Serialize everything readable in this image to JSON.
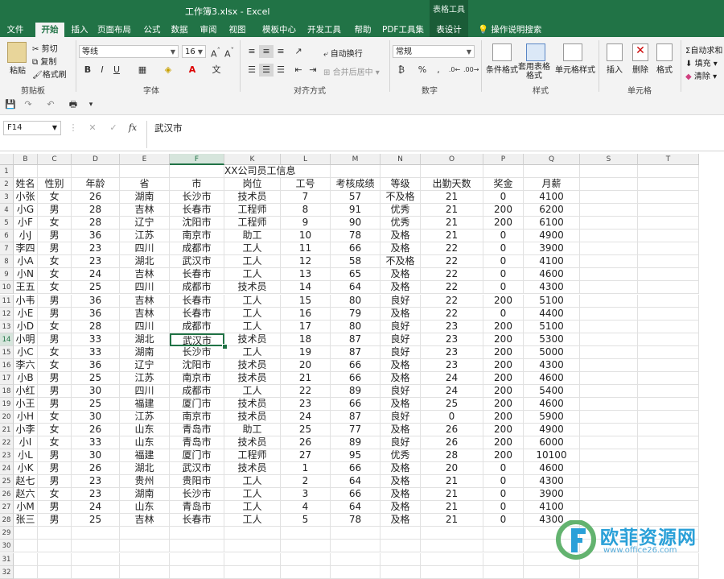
{
  "window": {
    "title": "工作簿3.xlsx  -  Excel",
    "context_group": "表格工具"
  },
  "tabs": [
    "文件",
    "开始",
    "插入",
    "页面布局",
    "公式",
    "数据",
    "审阅",
    "视图",
    "模板中心",
    "开发工具",
    "帮助",
    "PDF工具集",
    "表设计"
  ],
  "active_tab": "开始",
  "tell_me": "操作说明搜索",
  "ribbon": {
    "clipboard": {
      "paste": "粘贴",
      "cut": "剪切",
      "copy": "复制",
      "format_painter": "格式刷",
      "label": "剪贴板"
    },
    "font": {
      "name": "等线",
      "size": "16",
      "bold": "B",
      "italic": "I",
      "underline": "U",
      "label": "字体"
    },
    "alignment": {
      "wrap": "自动换行",
      "merge": "合并后居中",
      "label": "对齐方式"
    },
    "number": {
      "format": "常规",
      "percent": "%",
      "label": "数字"
    },
    "styles": {
      "conditional": "条件格式",
      "table": "套用表格格式",
      "cell_styles": "单元格样式",
      "label": "样式"
    },
    "cells": {
      "insert": "插入",
      "delete": "删除",
      "format": "格式",
      "label": "单元格"
    },
    "editing": {
      "autosum": "自动求和",
      "fill": "填充",
      "clear": "清除"
    }
  },
  "formula_bar": {
    "name_box": "F14",
    "content": "武汉市"
  },
  "columns": [
    "B",
    "C",
    "D",
    "E",
    "F",
    "K",
    "L",
    "M",
    "N",
    "O",
    "P",
    "Q",
    "S",
    "T"
  ],
  "selected_column": "F",
  "selected_row": 14,
  "sheet_title": "XX公司员工信息",
  "headers": [
    "姓名",
    "性别",
    "年龄",
    "省",
    "市",
    "岗位",
    "工号",
    "考核成绩",
    "等级",
    "出勤天数",
    "奖金",
    "月薪"
  ],
  "rows": [
    [
      "小张",
      "女",
      "26",
      "湖南",
      "长沙市",
      "技术员",
      "7",
      "57",
      "不及格",
      "21",
      "0",
      "4100"
    ],
    [
      "小G",
      "男",
      "28",
      "吉林",
      "长春市",
      "工程师",
      "8",
      "91",
      "优秀",
      "21",
      "200",
      "6200"
    ],
    [
      "小F",
      "女",
      "28",
      "辽宁",
      "沈阳市",
      "工程师",
      "9",
      "90",
      "优秀",
      "21",
      "200",
      "6100"
    ],
    [
      "小J",
      "男",
      "36",
      "江苏",
      "南京市",
      "助工",
      "10",
      "78",
      "及格",
      "21",
      "0",
      "4900"
    ],
    [
      "李四",
      "男",
      "23",
      "四川",
      "成都市",
      "工人",
      "11",
      "66",
      "及格",
      "22",
      "0",
      "3900"
    ],
    [
      "小A",
      "女",
      "23",
      "湖北",
      "武汉市",
      "工人",
      "12",
      "58",
      "不及格",
      "22",
      "0",
      "4100"
    ],
    [
      "小N",
      "女",
      "24",
      "吉林",
      "长春市",
      "工人",
      "13",
      "65",
      "及格",
      "22",
      "0",
      "4600"
    ],
    [
      "王五",
      "女",
      "25",
      "四川",
      "成都市",
      "技术员",
      "14",
      "64",
      "及格",
      "22",
      "0",
      "4300"
    ],
    [
      "小韦",
      "男",
      "36",
      "吉林",
      "长春市",
      "工人",
      "15",
      "80",
      "良好",
      "22",
      "200",
      "5100"
    ],
    [
      "小E",
      "男",
      "36",
      "吉林",
      "长春市",
      "工人",
      "16",
      "79",
      "及格",
      "22",
      "0",
      "4400"
    ],
    [
      "小D",
      "女",
      "28",
      "四川",
      "成都市",
      "工人",
      "17",
      "80",
      "良好",
      "23",
      "200",
      "5100"
    ],
    [
      "小明",
      "男",
      "33",
      "湖北",
      "武汉市",
      "技术员",
      "18",
      "87",
      "良好",
      "23",
      "200",
      "5300"
    ],
    [
      "小C",
      "女",
      "33",
      "湖南",
      "长沙市",
      "工人",
      "19",
      "87",
      "良好",
      "23",
      "200",
      "5000"
    ],
    [
      "李六",
      "女",
      "36",
      "辽宁",
      "沈阳市",
      "技术员",
      "20",
      "66",
      "及格",
      "23",
      "200",
      "4300"
    ],
    [
      "小B",
      "男",
      "25",
      "江苏",
      "南京市",
      "技术员",
      "21",
      "66",
      "及格",
      "24",
      "200",
      "4600"
    ],
    [
      "小红",
      "男",
      "30",
      "四川",
      "成都市",
      "工人",
      "22",
      "89",
      "良好",
      "24",
      "200",
      "5400"
    ],
    [
      "小王",
      "男",
      "25",
      "福建",
      "厦门市",
      "技术员",
      "23",
      "66",
      "及格",
      "25",
      "200",
      "4600"
    ],
    [
      "小H",
      "女",
      "30",
      "江苏",
      "南京市",
      "技术员",
      "24",
      "87",
      "良好",
      "0",
      "200",
      "5900"
    ],
    [
      "小李",
      "女",
      "26",
      "山东",
      "青岛市",
      "助工",
      "25",
      "77",
      "及格",
      "26",
      "200",
      "4900"
    ],
    [
      "小I",
      "女",
      "33",
      "山东",
      "青岛市",
      "技术员",
      "26",
      "89",
      "良好",
      "26",
      "200",
      "6000"
    ],
    [
      "小L",
      "男",
      "30",
      "福建",
      "厦门市",
      "工程师",
      "27",
      "95",
      "优秀",
      "28",
      "200",
      "10100"
    ],
    [
      "小K",
      "男",
      "26",
      "湖北",
      "武汉市",
      "技术员",
      "1",
      "66",
      "及格",
      "20",
      "0",
      "4600"
    ],
    [
      "赵七",
      "男",
      "23",
      "贵州",
      "贵阳市",
      "工人",
      "2",
      "64",
      "及格",
      "21",
      "0",
      "4300"
    ],
    [
      "赵六",
      "女",
      "23",
      "湖南",
      "长沙市",
      "工人",
      "3",
      "66",
      "及格",
      "21",
      "0",
      "3900"
    ],
    [
      "小M",
      "男",
      "24",
      "山东",
      "青岛市",
      "工人",
      "4",
      "64",
      "及格",
      "21",
      "0",
      "4100"
    ],
    [
      "张三",
      "男",
      "25",
      "吉林",
      "长春市",
      "工人",
      "5",
      "78",
      "及格",
      "21",
      "0",
      "4300"
    ]
  ],
  "row_numbers": [
    "1",
    "2",
    "3",
    "4",
    "5",
    "6",
    "7",
    "8",
    "9",
    "10",
    "11",
    "12",
    "13",
    "14",
    "15",
    "16",
    "17",
    "18",
    "19",
    "20",
    "21",
    "22",
    "23",
    "24",
    "25",
    "26",
    "27",
    "28",
    "29",
    "30",
    "31",
    "32"
  ],
  "watermark": {
    "text": "欧菲资源网",
    "url": "www.office26.com"
  }
}
